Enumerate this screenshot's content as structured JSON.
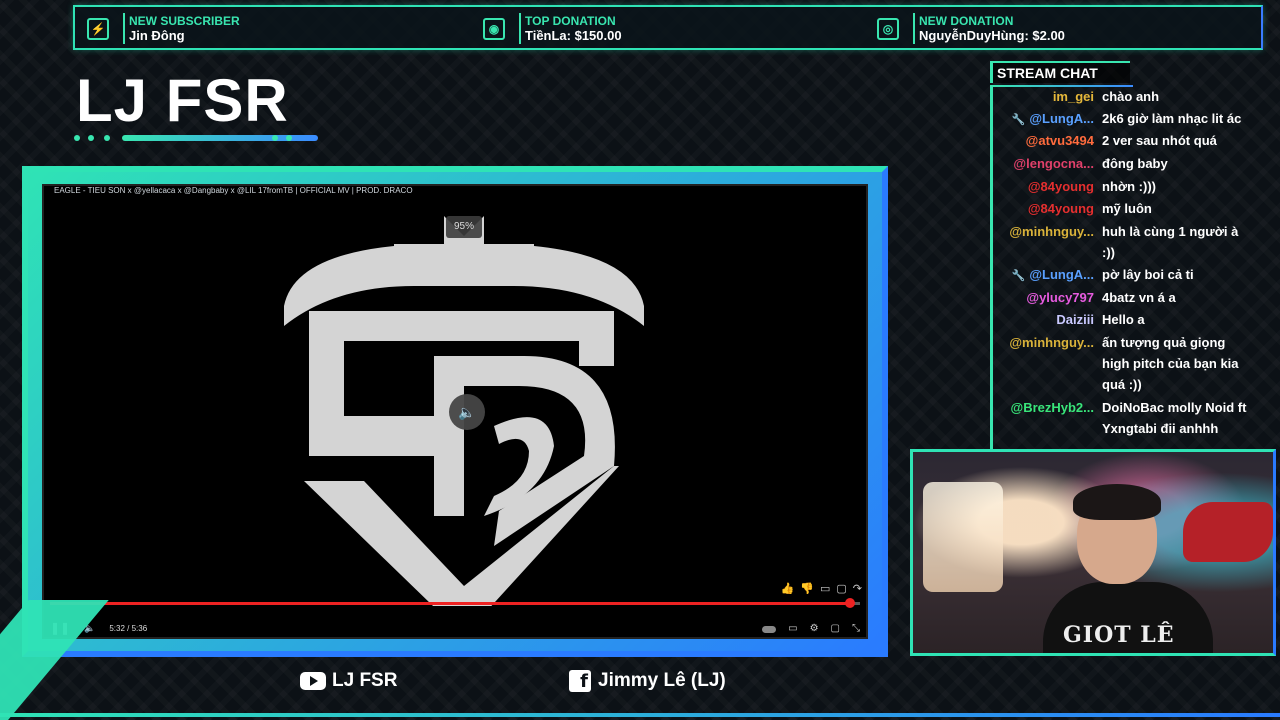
{
  "alerts": [
    {
      "label": "NEW SUBSCRIBER",
      "value": "Jin Đông",
      "icon": "lightning-icon"
    },
    {
      "label": "TOP DONATION",
      "value": "TiềnLa: $150.00",
      "icon": "camera-icon"
    },
    {
      "label": "NEW DONATION",
      "value": "NguyễnDuyHùng: $2.00",
      "icon": "cash-icon"
    }
  ],
  "channel": {
    "title": "LJ FSR"
  },
  "video": {
    "title": "EAGLE - TIEU SON x @yellacaca x @Dangbaby x @LIL 17fromTB | OFFICIAL MV | PROD. DRACO",
    "volume_badge": "95%",
    "time": "5:32 / 5:36",
    "progress": 0.988
  },
  "chat": {
    "title": "STREAM CHAT",
    "messages": [
      {
        "user": "im_gei",
        "color": "#e5b83a",
        "text": "chào anh",
        "mod": false
      },
      {
        "user": "@LungA...",
        "color": "#5aa0ff",
        "text": "2k6 giờ làm nhạc lit ác",
        "mod": true
      },
      {
        "user": "@atvu3494",
        "color": "#ff6b3d",
        "text": "2 ver sau nhót quá",
        "mod": false
      },
      {
        "user": "@lengocna...",
        "color": "#e0406a",
        "text": "đông baby",
        "mod": false
      },
      {
        "user": "@84young",
        "color": "#e52f2f",
        "text": "nhờn :)))",
        "mod": false
      },
      {
        "user": "@84young",
        "color": "#e52f2f",
        "text": "mỹ luôn",
        "mod": false
      },
      {
        "user": "@minhnguy...",
        "color": "#d9b23a",
        "text": "huh là cùng 1 người à :))",
        "mod": false
      },
      {
        "user": "@LungA...",
        "color": "#5aa0ff",
        "text": "pờ lây boi cả ti",
        "mod": true
      },
      {
        "user": "@ylucy797",
        "color": "#e75be0",
        "text": "4batz vn á a",
        "mod": false
      },
      {
        "user": "Daiziii",
        "color": "#c9c9ff",
        "text": "Hello a",
        "mod": false
      },
      {
        "user": "@minhnguy...",
        "color": "#d9b23a",
        "text": "ấn tượng quả giọng high pitch của bạn kia quá :))",
        "mod": false
      },
      {
        "user": "@BrezHyb2...",
        "color": "#39e67a",
        "text": "DoiNoBac molly Noid ft Yxngtabi đii anhhh",
        "mod": false
      }
    ]
  },
  "webcam": {
    "shirt_text": "GIOT LÊ"
  },
  "footer": {
    "youtube": "LJ FSR",
    "facebook": "Jimmy Lê (LJ)"
  },
  "colors": {
    "accent": "#2fe3b5",
    "accent2": "#2a7bff"
  }
}
